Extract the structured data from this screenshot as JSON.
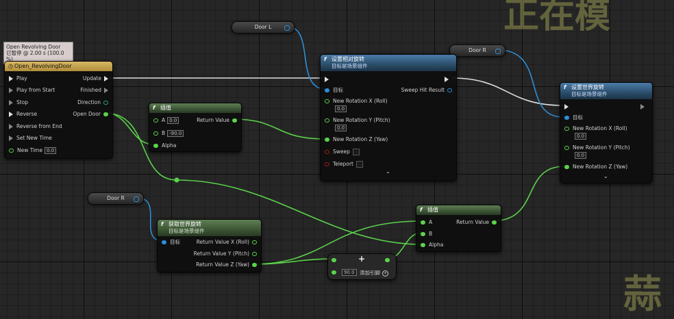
{
  "watermark": {
    "top": "正在模",
    "bottom": "蒜"
  },
  "colors": {
    "exec_wire": "#dddddd",
    "float_wire": "#5bd34b",
    "object_wire": "#2d8fd6",
    "blue_header": "#3a6d96",
    "green_header": "#4d6b45"
  },
  "timeline": {
    "status_line1": "Open Revolving Door",
    "status_line2": "已暂停 @ 2.00 s (100.0 %)",
    "title": "Open_RevolvingDoor",
    "in_pins": [
      "Play",
      "Play from Start",
      "Stop",
      "Reverse",
      "Reverse from End",
      "Set New Time"
    ],
    "new_time_label": "New Time",
    "new_time_value": "0.0",
    "out_update": "Update",
    "out_finished": "Finished",
    "out_direction": "Direction",
    "out_open_door": "Open Door"
  },
  "door_l": {
    "label": "Door L"
  },
  "door_r_top": {
    "label": "Door R"
  },
  "door_r_bottom": {
    "label": "Door R"
  },
  "lerp1": {
    "title": "插值",
    "a_label": "A",
    "a_value": "0.0",
    "b_label": "B",
    "b_value": "-90.0",
    "alpha_label": "Alpha",
    "return_label": "Return Value"
  },
  "lerp2": {
    "title": "插值",
    "a_label": "A",
    "b_label": "B",
    "alpha_label": "Alpha",
    "return_label": "Return Value"
  },
  "set_relative_rotation": {
    "title": "设置相对旋转",
    "subtitle": "目标是场景组件",
    "target_label": "目标",
    "sweep_label": "Sweep Hit Result",
    "rot_x_label": "New Rotation X (Roll)",
    "rot_x_value": "0.0",
    "rot_y_label": "New Rotation Y (Pitch)",
    "rot_y_value": "0.0",
    "rot_z_label": "New Rotation Z (Yaw)",
    "sweep_in_label": "Sweep",
    "teleport_label": "Teleport",
    "expand_icon": "chevron-up-icon"
  },
  "set_world_rotation": {
    "title": "设置世界旋转",
    "subtitle": "目标是场景组件",
    "target_label": "目标",
    "rot_x_label": "New Rotation X (Roll)",
    "rot_x_value": "0.0",
    "rot_y_label": "New Rotation Y (Pitch)",
    "rot_y_value": "0.0",
    "rot_z_label": "New Rotation Z (Yaw)",
    "expand_icon": "chevron-down-icon"
  },
  "get_world_rotation": {
    "title": "获取世界旋转",
    "subtitle": "目标是场景组件",
    "target_label": "目标",
    "out_x": "Return Value X (Roll)",
    "out_y": "Return Value Y (Pitch)",
    "out_z": "Return Value Z (Yaw)"
  },
  "add_node": {
    "plus": "+",
    "value": "90.0",
    "add_pin_label": "添加引脚"
  }
}
